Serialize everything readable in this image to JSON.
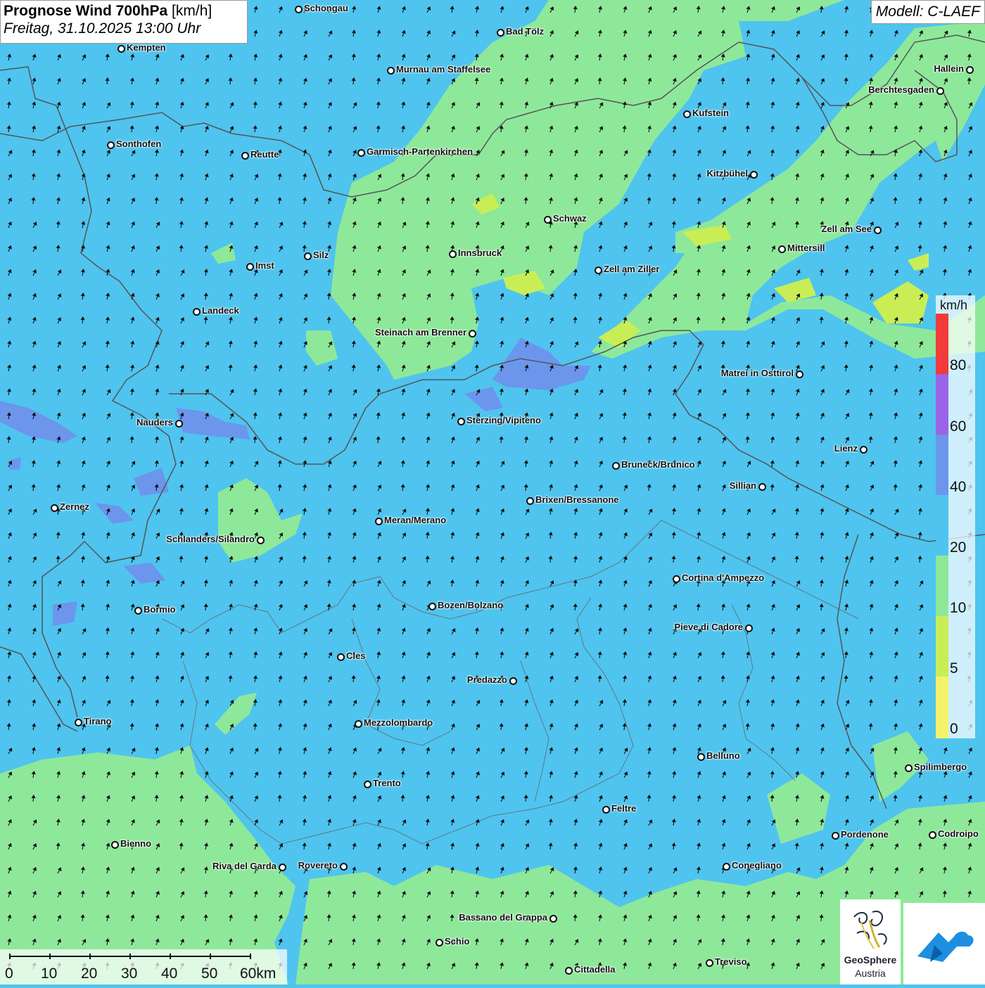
{
  "header": {
    "title_bold": "Prognose Wind 700hPa",
    "title_unit": "[km/h]",
    "datetime": "Freitag, 31.10.2025 13:00 Uhr",
    "model": "Modell: C-LAEF"
  },
  "colors": {
    "wind_10_20": "#8ee89a",
    "wind_20_40": "#4fc4ef",
    "wind_40_60": "#6b96ec",
    "wind_60_80": "#9c63e8",
    "wind_over_80": "#f33a3a",
    "wind_5_10": "#c9ee55",
    "wind_0_5": "#f3f36a",
    "border": "#555555",
    "arrow": "#111111"
  },
  "legend": {
    "unit": "km/h",
    "ticks": [
      "80",
      "60",
      "40",
      "20",
      "10",
      "5",
      "0"
    ]
  },
  "scale_bar": {
    "labels": [
      "0",
      "10",
      "20",
      "30",
      "40",
      "50",
      "60km"
    ]
  },
  "logos": {
    "geosphere_line1": "GeoSphere",
    "geosphere_line2": "Austria",
    "cloud_icon": "cloud-arrow-logo-icon"
  },
  "cities": [
    {
      "name": "Schongau"
    },
    {
      "name": "Bad Tölz"
    },
    {
      "name": "Kempten"
    },
    {
      "name": "Hallein"
    },
    {
      "name": "Murnau am Staffelsee"
    },
    {
      "name": "Berchtesgaden"
    },
    {
      "name": "Kufstein"
    },
    {
      "name": "Sonthofen"
    },
    {
      "name": "Garmisch-Partenkirchen"
    },
    {
      "name": "Reutte"
    },
    {
      "name": "Kitzbühel"
    },
    {
      "name": "Schwaz"
    },
    {
      "name": "Zell am See"
    },
    {
      "name": "Innsbruck"
    },
    {
      "name": "Mittersill"
    },
    {
      "name": "Silz"
    },
    {
      "name": "Imst"
    },
    {
      "name": "Zell am Ziller"
    },
    {
      "name": "Landeck"
    },
    {
      "name": "Steinach am Brenner"
    },
    {
      "name": "Matrei in Osttirol"
    },
    {
      "name": "Nauders"
    },
    {
      "name": "Sterzing/Vipiteno"
    },
    {
      "name": "Lienz"
    },
    {
      "name": "Bruneck/Brunico"
    },
    {
      "name": "Sillian"
    },
    {
      "name": "Brixen/Bressanone"
    },
    {
      "name": "Zernez"
    },
    {
      "name": "Meran/Merano"
    },
    {
      "name": "Schlanders/Silandro"
    },
    {
      "name": "Cortina d'Ampezzo"
    },
    {
      "name": "Bozen/Bolzano"
    },
    {
      "name": "Bormio"
    },
    {
      "name": "Pieve di Cadore"
    },
    {
      "name": "Cles"
    },
    {
      "name": "Predazzo"
    },
    {
      "name": "Tirano"
    },
    {
      "name": "Mezzolombardo"
    },
    {
      "name": "Belluno"
    },
    {
      "name": "Spilimbergo"
    },
    {
      "name": "Trento"
    },
    {
      "name": "Feltre"
    },
    {
      "name": "Bienno"
    },
    {
      "name": "Pordenone"
    },
    {
      "name": "Codroipo"
    },
    {
      "name": "Riva del Garda"
    },
    {
      "name": "Rovereto"
    },
    {
      "name": "Conegliano"
    },
    {
      "name": "Bassano del Grappa"
    },
    {
      "name": "Schio"
    },
    {
      "name": "Treviso"
    },
    {
      "name": "Cittadella"
    }
  ]
}
